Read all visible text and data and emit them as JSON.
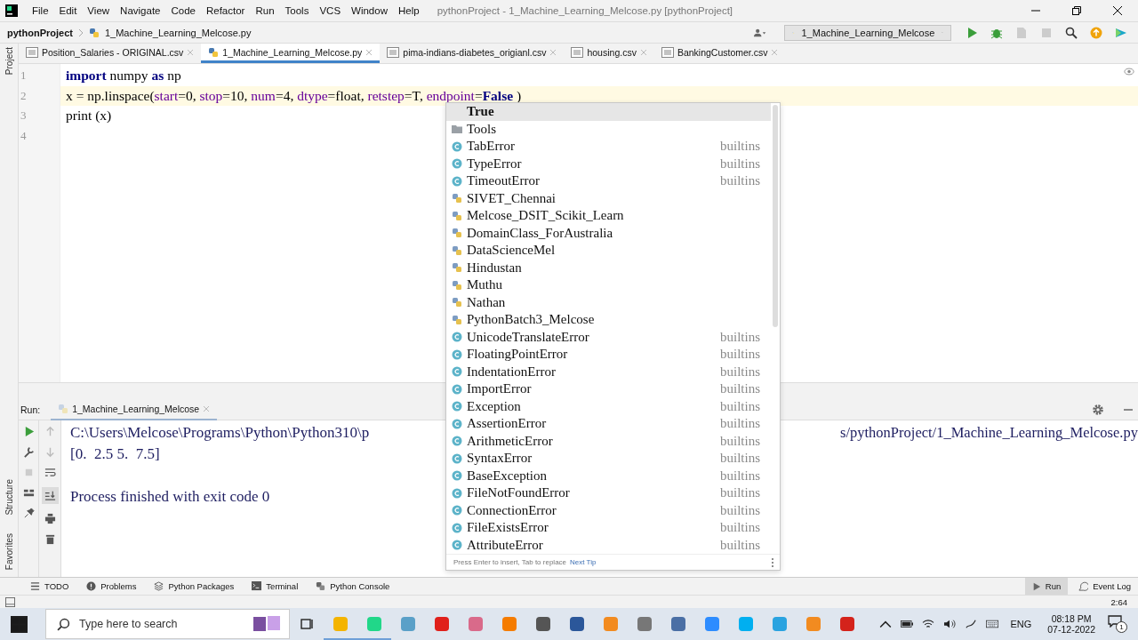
{
  "window": {
    "title": "pythonProject - 1_Machine_Learning_Melcose.py [pythonProject]"
  },
  "menu": [
    "File",
    "Edit",
    "View",
    "Navigate",
    "Code",
    "Refactor",
    "Run",
    "Tools",
    "VCS",
    "Window",
    "Help"
  ],
  "breadcrumb": [
    "pythonProject",
    "1_Machine_Learning_Melcose.py"
  ],
  "run_config": "1_Machine_Learning_Melcose",
  "tabs": [
    {
      "label": "Position_Salaries - ORIGINAL.csv",
      "kind": "csv",
      "selected": false
    },
    {
      "label": "1_Machine_Learning_Melcose.py",
      "kind": "py",
      "selected": true
    },
    {
      "label": "pima-indians-diabetes_origianl.csv",
      "kind": "csv",
      "selected": false
    },
    {
      "label": "housing.csv",
      "kind": "csv",
      "selected": false
    },
    {
      "label": "BankingCustomer.csv",
      "kind": "csv",
      "selected": false
    }
  ],
  "side_tools_top": [
    "Project"
  ],
  "side_tools_bottom": [
    "Structure",
    "Favorites"
  ],
  "editor": {
    "lines": [
      {
        "number": "1",
        "current": false,
        "tokens": [
          {
            "text": "import",
            "kind": "keyword"
          },
          {
            "text": " numpy ",
            "kind": "plain"
          },
          {
            "text": "as",
            "kind": "keyword"
          },
          {
            "text": " np",
            "kind": "plain"
          }
        ]
      },
      {
        "number": "2",
        "current": true,
        "tokens": [
          {
            "text": "x = np.linspace(",
            "kind": "plain"
          },
          {
            "text": "start",
            "kind": "param"
          },
          {
            "text": "=0, ",
            "kind": "plain"
          },
          {
            "text": "stop",
            "kind": "param"
          },
          {
            "text": "=10, ",
            "kind": "plain"
          },
          {
            "text": "num",
            "kind": "param"
          },
          {
            "text": "=4, ",
            "kind": "plain"
          },
          {
            "text": "dtype",
            "kind": "param"
          },
          {
            "text": "=float, ",
            "kind": "plain"
          },
          {
            "text": "retstep",
            "kind": "param"
          },
          {
            "text": "=T, ",
            "kind": "plain"
          },
          {
            "text": "endpoint",
            "kind": "param"
          },
          {
            "text": "=",
            "kind": "plain"
          },
          {
            "text": "False",
            "kind": "keyword"
          },
          {
            "text": " )",
            "kind": "plain"
          }
        ]
      },
      {
        "number": "3",
        "current": false,
        "tokens": [
          {
            "text": "print (x)",
            "kind": "plain"
          }
        ]
      },
      {
        "number": "4",
        "current": false
      }
    ]
  },
  "completion": {
    "items": [
      {
        "label": "True",
        "kind": "keyword",
        "selected": true
      },
      {
        "label": "Tools",
        "kind": "folder",
        "selected": false
      },
      {
        "label": "TabError",
        "kind": "class",
        "source": "builtins",
        "selected": false
      },
      {
        "label": "TypeError",
        "kind": "class",
        "source": "builtins",
        "selected": false
      },
      {
        "label": "TimeoutError",
        "kind": "class",
        "source": "builtins",
        "selected": false
      },
      {
        "label": "SIVET_Chennai",
        "kind": "module",
        "selected": false
      },
      {
        "label": "Melcose_DSIT_Scikit_Learn",
        "kind": "module",
        "selected": false
      },
      {
        "label": "DomainClass_ForAustralia",
        "kind": "module",
        "selected": false
      },
      {
        "label": "DataScienceMel",
        "kind": "module",
        "selected": false
      },
      {
        "label": "Hindustan",
        "kind": "module",
        "selected": false
      },
      {
        "label": "Muthu",
        "kind": "module",
        "selected": false
      },
      {
        "label": "Nathan",
        "kind": "module",
        "selected": false
      },
      {
        "label": "PythonBatch3_Melcose",
        "kind": "module",
        "selected": false
      },
      {
        "label": "UnicodeTranslateError",
        "kind": "class",
        "source": "builtins",
        "selected": false
      },
      {
        "label": "FloatingPointError",
        "kind": "class",
        "source": "builtins",
        "selected": false
      },
      {
        "label": "IndentationError",
        "kind": "class",
        "source": "builtins",
        "selected": false
      },
      {
        "label": "ImportError",
        "kind": "class",
        "source": "builtins",
        "selected": false
      },
      {
        "label": "Exception",
        "kind": "class",
        "source": "builtins",
        "selected": false
      },
      {
        "label": "AssertionError",
        "kind": "class",
        "source": "builtins",
        "selected": false
      },
      {
        "label": "ArithmeticError",
        "kind": "class",
        "source": "builtins",
        "selected": false
      },
      {
        "label": "SyntaxError",
        "kind": "class",
        "source": "builtins",
        "selected": false
      },
      {
        "label": "BaseException",
        "kind": "class",
        "source": "builtins",
        "selected": false
      },
      {
        "label": "FileNotFoundError",
        "kind": "class",
        "source": "builtins",
        "selected": false
      },
      {
        "label": "ConnectionError",
        "kind": "class",
        "source": "builtins",
        "selected": false
      },
      {
        "label": "FileExistsError",
        "kind": "class",
        "source": "builtins",
        "selected": false
      },
      {
        "label": "AttributeError",
        "kind": "class",
        "source": "builtins",
        "selected": false
      }
    ],
    "hint": "Press Enter to insert, Tab to replace",
    "hint_link": "Next Tip"
  },
  "run_panel": {
    "label": "Run:",
    "tab": "1_Machine_Learning_Melcose",
    "path_start": "C:\\Users\\Melcose\\Programs\\Python\\Python310\\p",
    "path_end": "s/pythonProject/1_Machine_Learning_Melcose.py",
    "output": "[0.  2.5 5.  7.5]",
    "exit": "Process finished with exit code 0"
  },
  "tool_tabs": [
    {
      "label": "TODO",
      "kind": "list"
    },
    {
      "label": "Problems",
      "kind": "alert"
    },
    {
      "label": "Python Packages",
      "kind": "layers"
    },
    {
      "label": "Terminal",
      "kind": "terminal"
    },
    {
      "label": "Python Console",
      "kind": "python"
    }
  ],
  "tool_tabs_right": [
    {
      "label": "Run",
      "kind": "run",
      "selected": true
    },
    {
      "label": "Event Log",
      "kind": "log",
      "selected": false
    }
  ],
  "status_bar": {
    "position": "2:64"
  },
  "taskbar": {
    "search": "Type here to search",
    "language": "ENG",
    "time": "08:18 PM",
    "date": "07-12-2022",
    "notifications": "1"
  }
}
